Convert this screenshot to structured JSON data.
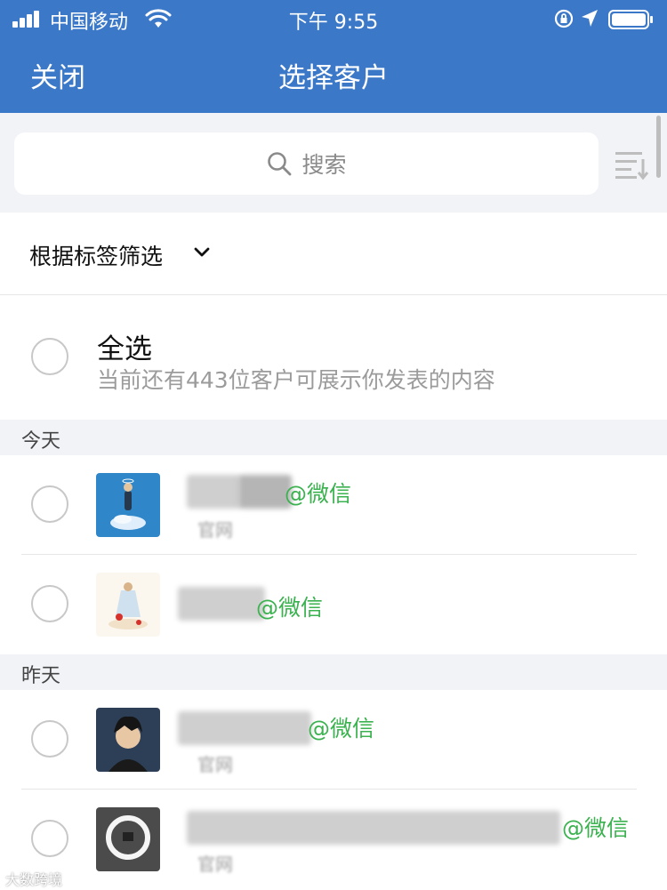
{
  "status_bar": {
    "carrier": "中国移动",
    "time": "下午 9:55"
  },
  "nav": {
    "close_label": "关闭",
    "title": "选择客户"
  },
  "search": {
    "placeholder": "搜索",
    "icon": "search-icon"
  },
  "filter": {
    "label": "根据标签筛选",
    "icon": "chevron-down-icon"
  },
  "select_all": {
    "title": "全选",
    "subtitle": "当前还有443位客户可展示你发表的内容"
  },
  "sections": [
    {
      "label": "今天",
      "items": [
        {
          "suffix": "@微信",
          "sub": "官网"
        },
        {
          "suffix": "@微信",
          "sub": ""
        }
      ]
    },
    {
      "label": "昨天",
      "items": [
        {
          "suffix": "@微信",
          "sub": "官网"
        },
        {
          "suffix": "@微信",
          "sub": "官网"
        }
      ]
    }
  ],
  "watermark": "大数跨境",
  "colors": {
    "header_blue": "#3b78c8",
    "wechat_green": "#3bb24f",
    "section_bg": "#f2f3f7"
  }
}
